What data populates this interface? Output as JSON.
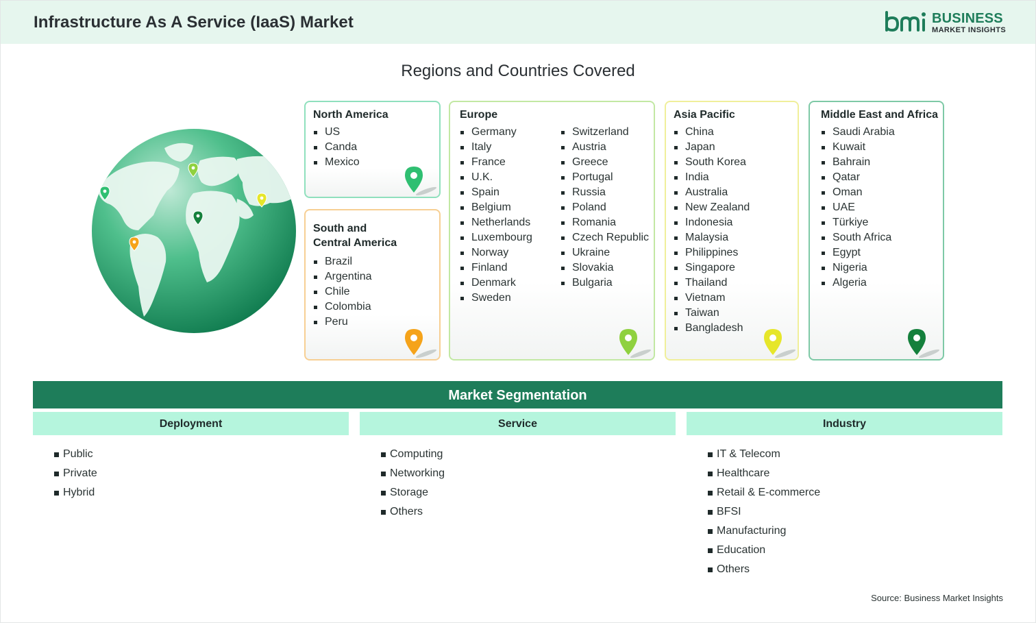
{
  "header": {
    "title": "Infrastructure As A Service (IaaS) Market"
  },
  "logo": {
    "line1": "BUSINESS",
    "line2": "MARKET INSIGHTS",
    "brand_color": "#1e7d5a"
  },
  "regions": {
    "title": "Regions and Countries Covered",
    "north_america": {
      "title": "North America",
      "items": [
        "US",
        "Canda",
        "Mexico"
      ],
      "pin_color": "#2fbf71",
      "border_color": "#8fe0bd"
    },
    "south_central_america": {
      "title_line1": "South and",
      "title_line2": "Central America",
      "items": [
        "Brazil",
        "Argentina",
        "Chile",
        "Colombia",
        "Peru"
      ],
      "pin_color": "#f5a31a",
      "border_color": "#f7cf93"
    },
    "europe": {
      "title": "Europe",
      "col1": [
        "Germany",
        "Italy",
        "France",
        "U.K.",
        "Spain",
        "Belgium",
        "Netherlands",
        "Luxembourg",
        "Norway",
        "Finland",
        "Denmark",
        "Sweden"
      ],
      "col2": [
        "Switzerland",
        "Austria",
        "Greece",
        "Portugal",
        "Russia",
        "Poland",
        "Romania",
        "Czech Republic",
        "Ukraine",
        "Slovakia",
        "Bulgaria"
      ],
      "pin_color": "#8fd13f",
      "border_color": "#c2e8a3"
    },
    "asia_pacific": {
      "title": "Asia Pacific",
      "items": [
        "China",
        "Japan",
        "South Korea",
        "India",
        "Australia",
        "New Zealand",
        "Indonesia",
        "Malaysia",
        "Philippines",
        "Singapore",
        "Thailand",
        "Vietnam",
        "Taiwan",
        "Bangladesh"
      ],
      "pin_color": "#e6e62a",
      "border_color": "#f0ef9a"
    },
    "middle_east_africa": {
      "title": "Middle East and Africa",
      "items": [
        "Saudi Arabia",
        "Kuwait",
        "Bahrain",
        "Qatar",
        "Oman",
        "UAE",
        "Türkiye",
        "South Africa",
        "Egypt",
        "Nigeria",
        "Algeria"
      ],
      "pin_color": "#14803c",
      "border_color": "#7ec9a6"
    }
  },
  "segmentation": {
    "title": "Market Segmentation",
    "deployment": {
      "title": "Deployment",
      "items": [
        "Public",
        "Private",
        "Hybrid"
      ]
    },
    "service": {
      "title": "Service",
      "items": [
        "Computing",
        "Networking",
        "Storage",
        "Others"
      ]
    },
    "industry": {
      "title": "Industry",
      "items": [
        "IT & Telecom",
        "Healthcare",
        "Retail & E-commerce",
        "BFSI",
        "Manufacturing",
        "Education",
        "Others"
      ]
    }
  },
  "source": "Source: Business Market Insights",
  "icons": {
    "globe": "globe-icon",
    "pin": "map-pin-icon",
    "logo": "bmi-logo-icon"
  }
}
